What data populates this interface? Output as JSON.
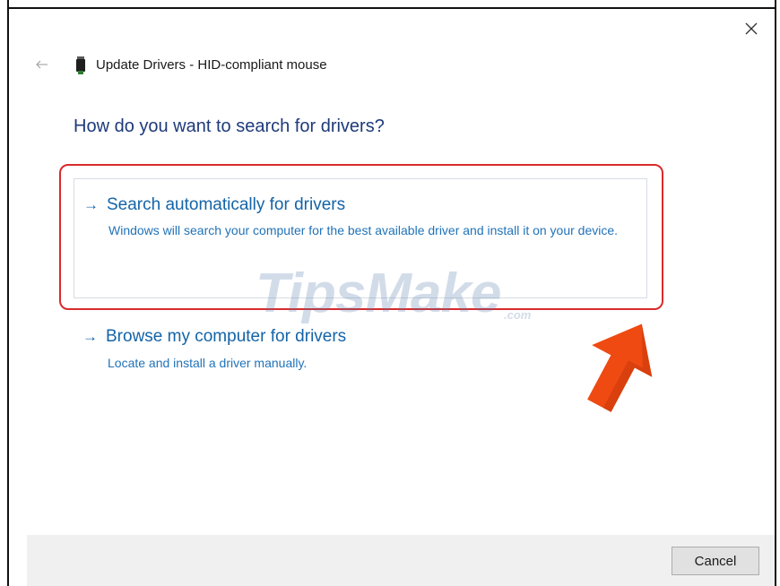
{
  "window": {
    "title": "Update Drivers - HID-compliant mouse",
    "close_icon": "close-icon",
    "back_icon": "back-arrow-icon",
    "device_icon": "usb-device-icon"
  },
  "main": {
    "heading": "How do you want to search for drivers?",
    "options": [
      {
        "arrow": "→",
        "title": "Search automatically for drivers",
        "description": "Windows will search your computer for the best available driver and install it on your device."
      },
      {
        "arrow": "→",
        "title": "Browse my computer for drivers",
        "description": "Locate and install a driver manually."
      }
    ]
  },
  "overlay": {
    "watermark": "TipsMake",
    "watermark_suffix": ".com",
    "highlight_color": "#d92b2b",
    "arrow_color": "#ee4a12"
  },
  "footer": {
    "cancel_label": "Cancel"
  },
  "colors": {
    "heading": "#1e3a7a",
    "link": "#1464a8"
  }
}
